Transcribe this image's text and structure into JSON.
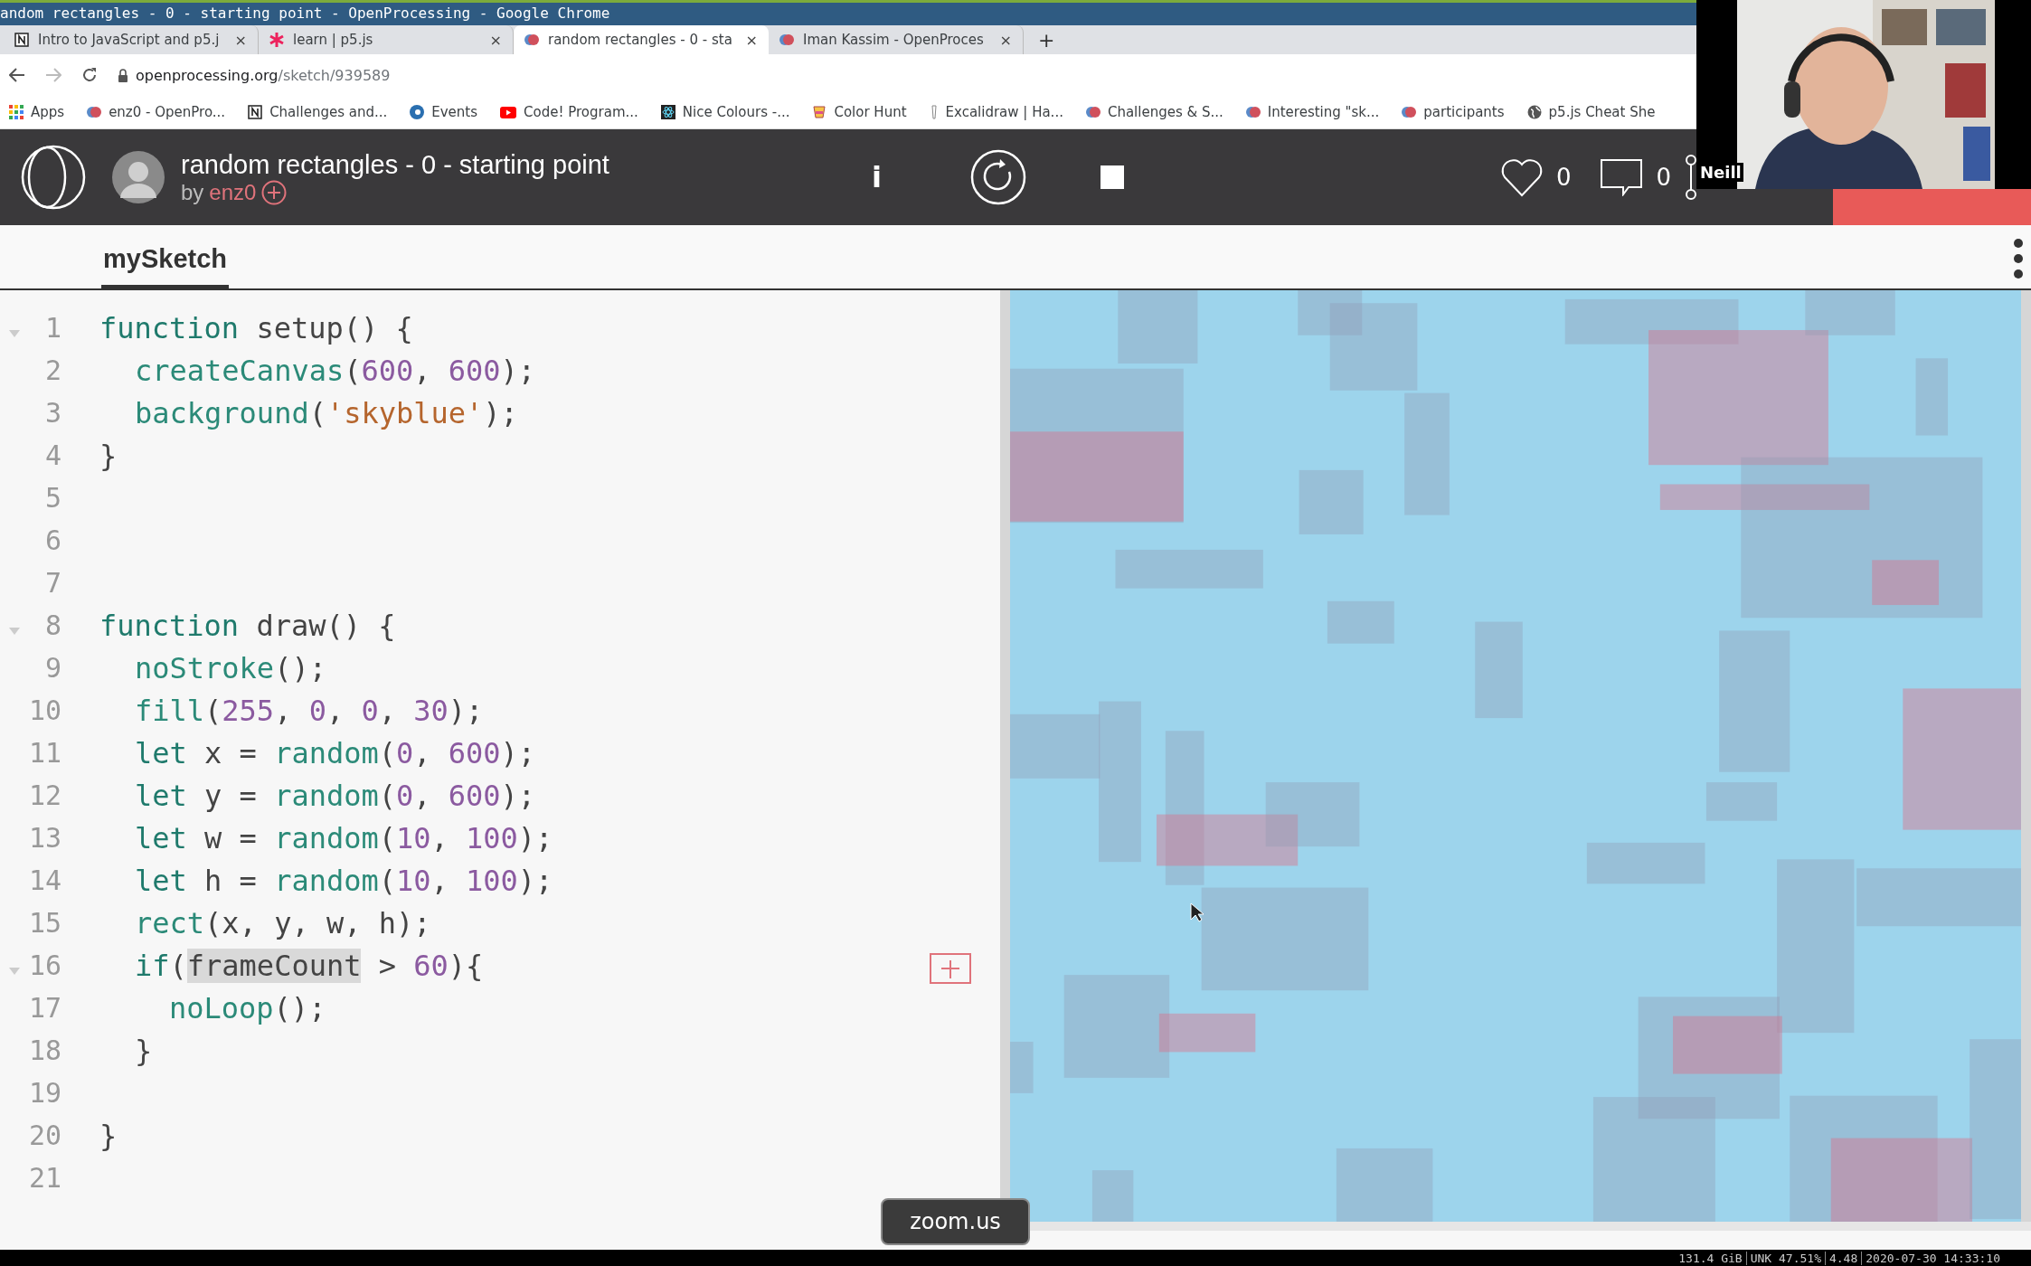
{
  "window": {
    "title": "andom rectangles - 0 - starting point - OpenProcessing - Google Chrome"
  },
  "tabs": [
    {
      "title": "Intro to JavaScript and p5.j",
      "kind": "notion",
      "close": "×",
      "selected": false
    },
    {
      "title": "learn | p5.js",
      "kind": "star",
      "close": "×",
      "selected": false
    },
    {
      "title": "random rectangles - 0 - sta",
      "kind": "op",
      "close": "×",
      "selected": true
    },
    {
      "title": "Iman Kassim - OpenProces",
      "kind": "op",
      "close": "×",
      "selected": false
    }
  ],
  "new_tab": "+",
  "address_bar": {
    "host": "openprocessing.org",
    "path": "/sketch/939589"
  },
  "bookmarks": [
    {
      "label": "Apps",
      "kind": "apps"
    },
    {
      "label": "enz0 - OpenPro...",
      "kind": "op"
    },
    {
      "label": "Challenges and...",
      "kind": "notion"
    },
    {
      "label": "Events",
      "kind": "ring"
    },
    {
      "label": "Code! Program...",
      "kind": "video"
    },
    {
      "label": "Nice Colours -...",
      "kind": "atom"
    },
    {
      "label": "Color Hunt",
      "kind": "cup"
    },
    {
      "label": "Excalidraw | Ha...",
      "kind": "pen"
    },
    {
      "label": "Challenges & S...",
      "kind": "op"
    },
    {
      "label": "Interesting \"sk...",
      "kind": "op"
    },
    {
      "label": "participants",
      "kind": "op"
    },
    {
      "label": "p5.js Cheat She",
      "kind": "globe"
    }
  ],
  "sketch": {
    "title": "random rectangles - 0 - starting point",
    "by": "by",
    "author": "enz0"
  },
  "toolbar": {
    "info": "i",
    "likes": "0",
    "comments": "0"
  },
  "file_tabs": [
    {
      "label": "mySketch",
      "selected": true
    }
  ],
  "code": [
    {
      "number": "1",
      "kind": "top",
      "foldable": true,
      "tokens": [
        {
          "kind": "keyword",
          "text": "function"
        },
        {
          "kind": "plain",
          "text": " setup() {"
        }
      ]
    },
    {
      "number": "2",
      "kind": "body",
      "foldable": false,
      "tokens": [
        {
          "kind": "call",
          "text": "createCanvas"
        },
        {
          "kind": "plain",
          "text": "("
        },
        {
          "kind": "number",
          "text": "600"
        },
        {
          "kind": "plain",
          "text": ", "
        },
        {
          "kind": "number",
          "text": "600"
        },
        {
          "kind": "plain",
          "text": ");"
        }
      ]
    },
    {
      "number": "3",
      "kind": "body",
      "foldable": false,
      "tokens": [
        {
          "kind": "call",
          "text": "background"
        },
        {
          "kind": "plain",
          "text": "("
        },
        {
          "kind": "string",
          "text": "'skyblue'"
        },
        {
          "kind": "plain",
          "text": ");"
        }
      ]
    },
    {
      "number": "4",
      "kind": "top",
      "foldable": false,
      "tokens": [
        {
          "kind": "plain",
          "text": "}"
        }
      ]
    },
    {
      "number": "5",
      "foldable": false
    },
    {
      "number": "6",
      "foldable": false
    },
    {
      "number": "7",
      "foldable": false
    },
    {
      "number": "8",
      "kind": "top",
      "foldable": true,
      "tokens": [
        {
          "kind": "keyword",
          "text": "function"
        },
        {
          "kind": "plain",
          "text": " draw() {"
        }
      ]
    },
    {
      "number": "9",
      "kind": "body",
      "foldable": false,
      "tokens": [
        {
          "kind": "call",
          "text": "noStroke"
        },
        {
          "kind": "plain",
          "text": "();"
        }
      ]
    },
    {
      "number": "10",
      "kind": "body",
      "foldable": false,
      "tokens": [
        {
          "kind": "call",
          "text": "fill"
        },
        {
          "kind": "plain",
          "text": "("
        },
        {
          "kind": "number",
          "text": "255"
        },
        {
          "kind": "plain",
          "text": ", "
        },
        {
          "kind": "number",
          "text": "0"
        },
        {
          "kind": "plain",
          "text": ", "
        },
        {
          "kind": "number",
          "text": "0"
        },
        {
          "kind": "plain",
          "text": ", "
        },
        {
          "kind": "number",
          "text": "30"
        },
        {
          "kind": "plain",
          "text": ");"
        }
      ]
    },
    {
      "number": "11",
      "kind": "body",
      "foldable": false,
      "tokens": [
        {
          "kind": "keyword",
          "text": "let"
        },
        {
          "kind": "plain",
          "text": " x = "
        },
        {
          "kind": "call",
          "text": "random"
        },
        {
          "kind": "plain",
          "text": "("
        },
        {
          "kind": "number",
          "text": "0"
        },
        {
          "kind": "plain",
          "text": ", "
        },
        {
          "kind": "number",
          "text": "600"
        },
        {
          "kind": "plain",
          "text": ");"
        }
      ]
    },
    {
      "number": "12",
      "kind": "body",
      "foldable": false,
      "tokens": [
        {
          "kind": "keyword",
          "text": "let"
        },
        {
          "kind": "plain",
          "text": " y = "
        },
        {
          "kind": "call",
          "text": "random"
        },
        {
          "kind": "plain",
          "text": "("
        },
        {
          "kind": "number",
          "text": "0"
        },
        {
          "kind": "plain",
          "text": ", "
        },
        {
          "kind": "number",
          "text": "600"
        },
        {
          "kind": "plain",
          "text": ");"
        }
      ]
    },
    {
      "number": "13",
      "kind": "body",
      "foldable": false,
      "tokens": [
        {
          "kind": "keyword",
          "text": "let"
        },
        {
          "kind": "plain",
          "text": " w = "
        },
        {
          "kind": "call",
          "text": "random"
        },
        {
          "kind": "plain",
          "text": "("
        },
        {
          "kind": "number",
          "text": "10"
        },
        {
          "kind": "plain",
          "text": ", "
        },
        {
          "kind": "number",
          "text": "100"
        },
        {
          "kind": "plain",
          "text": ");"
        }
      ]
    },
    {
      "number": "14",
      "kind": "body",
      "foldable": false,
      "tokens": [
        {
          "kind": "keyword",
          "text": "let"
        },
        {
          "kind": "plain",
          "text": " h = "
        },
        {
          "kind": "call",
          "text": "random"
        },
        {
          "kind": "plain",
          "text": "("
        },
        {
          "kind": "number",
          "text": "10"
        },
        {
          "kind": "plain",
          "text": ", "
        },
        {
          "kind": "number",
          "text": "100"
        },
        {
          "kind": "plain",
          "text": ");"
        }
      ]
    },
    {
      "number": "15",
      "kind": "body",
      "foldable": false,
      "tokens": [
        {
          "kind": "call",
          "text": "rect"
        },
        {
          "kind": "plain",
          "text": "(x, y, w, h);"
        }
      ]
    },
    {
      "number": "16",
      "kind": "body",
      "foldable": true,
      "tokens": [
        {
          "kind": "keyword",
          "text": "if"
        },
        {
          "kind": "plain",
          "text": "("
        },
        {
          "kind": "highlight",
          "text": "frameCount"
        },
        {
          "kind": "plain",
          "text": " > "
        },
        {
          "kind": "number",
          "text": "60"
        },
        {
          "kind": "plain",
          "text": "){"
        }
      ]
    },
    {
      "number": "17",
      "kind": "inner",
      "foldable": false,
      "tokens": [
        {
          "kind": "call",
          "text": "noLoop"
        },
        {
          "kind": "plain",
          "text": "();"
        }
      ]
    },
    {
      "number": "18",
      "kind": "body",
      "foldable": false,
      "tokens": [
        {
          "kind": "plain",
          "text": "}"
        }
      ]
    },
    {
      "number": "19",
      "foldable": false
    },
    {
      "number": "20",
      "kind": "top",
      "foldable": false,
      "tokens": [
        {
          "kind": "plain",
          "text": "}"
        }
      ]
    },
    {
      "number": "21",
      "foldable": false
    }
  ],
  "webcam": {
    "name": "Neill"
  },
  "tooltip": "zoom.us",
  "status_bar": [
    "131.4 GiB",
    "UNK 47.51%",
    "4.48",
    "2020-07-30 14:33:10"
  ]
}
